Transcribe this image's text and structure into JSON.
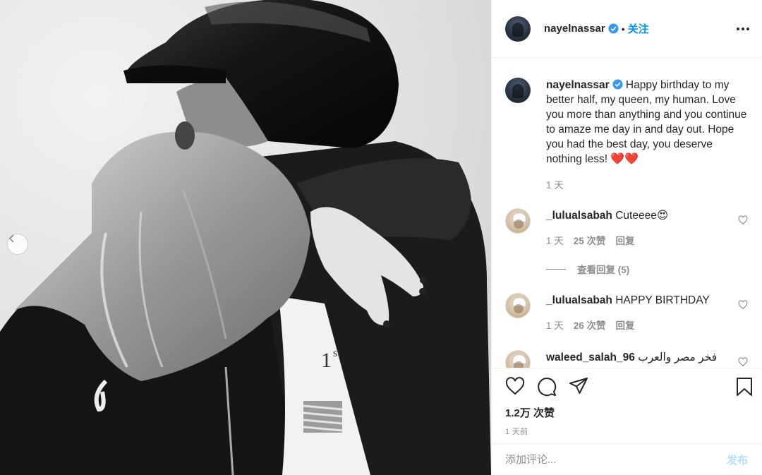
{
  "post": {
    "username": "nayelnassar",
    "follow_label": "关注",
    "separator": "•"
  },
  "caption": {
    "username": "nayelnassar",
    "text": " Happy birthday to my better half, my queen, my human. Love you more than anything and you continue to amaze me day in and day out. Hope you had the best day, you deserve nothing less! ",
    "emoji": "❤️❤️",
    "time": "1 天"
  },
  "comments": [
    {
      "username": "_lulualsabah",
      "text": " Cuteeee😍",
      "time": "1 天",
      "likes": "25 次赞",
      "reply_label": "回复"
    },
    {
      "username": "_lulualsabah",
      "text": " HAPPY BIRTHDAY",
      "time": "1 天",
      "likes": "26 次赞",
      "reply_label": "回复"
    },
    {
      "username": "waleed_salah_96",
      "text": " فخر مصر والعرب",
      "time": "",
      "likes": "",
      "reply_label": ""
    }
  ],
  "view_replies": "查看回复 (5)",
  "actions": {
    "likes_count": "1.2万 次赞",
    "time_ago": "1 天前"
  },
  "composer": {
    "placeholder": "添加评论...",
    "publish_label": "发布"
  },
  "colors": {
    "link_blue": "#0095f6",
    "publish_disabled": "#b2dffc",
    "heart_red": "#e0245e"
  },
  "icons": [
    "chevron-left-icon",
    "verified-icon",
    "more-icon",
    "heart-icon",
    "comment-icon",
    "share-icon",
    "bookmark-icon"
  ]
}
